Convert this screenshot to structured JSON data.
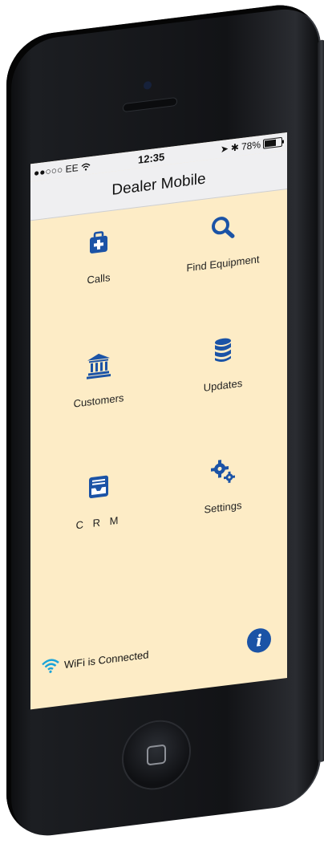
{
  "status": {
    "carrier": "●●○○○ EE",
    "time": "12:35",
    "battery": "78%",
    "battery_level": 0.78
  },
  "nav": {
    "title": "Dealer Mobile"
  },
  "menu": [
    {
      "label": "Calls",
      "icon": "medical-bag-icon"
    },
    {
      "label": "Find Equipment",
      "icon": "search-icon"
    },
    {
      "label": "Customers",
      "icon": "bank-icon"
    },
    {
      "label": "Updates",
      "icon": "database-icon"
    },
    {
      "label": "C R M",
      "icon": "inbox-tray-icon"
    },
    {
      "label": "Settings",
      "icon": "cogs-icon"
    }
  ],
  "footer": {
    "wifi_text": "WiFi is Connected",
    "info_label": "i"
  },
  "colors": {
    "accent": "#1b53a6",
    "screen_bg": "#fdecc6",
    "bar_bg": "#efeff1",
    "wifi": "#1aa3d9"
  }
}
